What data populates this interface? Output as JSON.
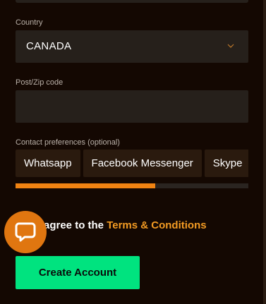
{
  "country": {
    "label": "Country",
    "value": "CANADA"
  },
  "postcode": {
    "label": "Post/Zip code",
    "value": ""
  },
  "contact_preferences": {
    "label": "Contact preferences (optional)",
    "options": [
      "Whatsapp",
      "Facebook Messenger",
      "Skype"
    ],
    "scroll_position": 0.6
  },
  "terms": {
    "prefix": "agree to the",
    "link": "Terms & Conditions"
  },
  "create_account": {
    "label": "Create Account"
  },
  "colors": {
    "background": "#140802",
    "input_bg": "#26201b",
    "accent": "#f39b23",
    "chat_button": "#e07610",
    "primary_button": "#00e37f"
  },
  "icons": {
    "chat": "chat-icon",
    "dropdown": "chevron-down-icon"
  }
}
